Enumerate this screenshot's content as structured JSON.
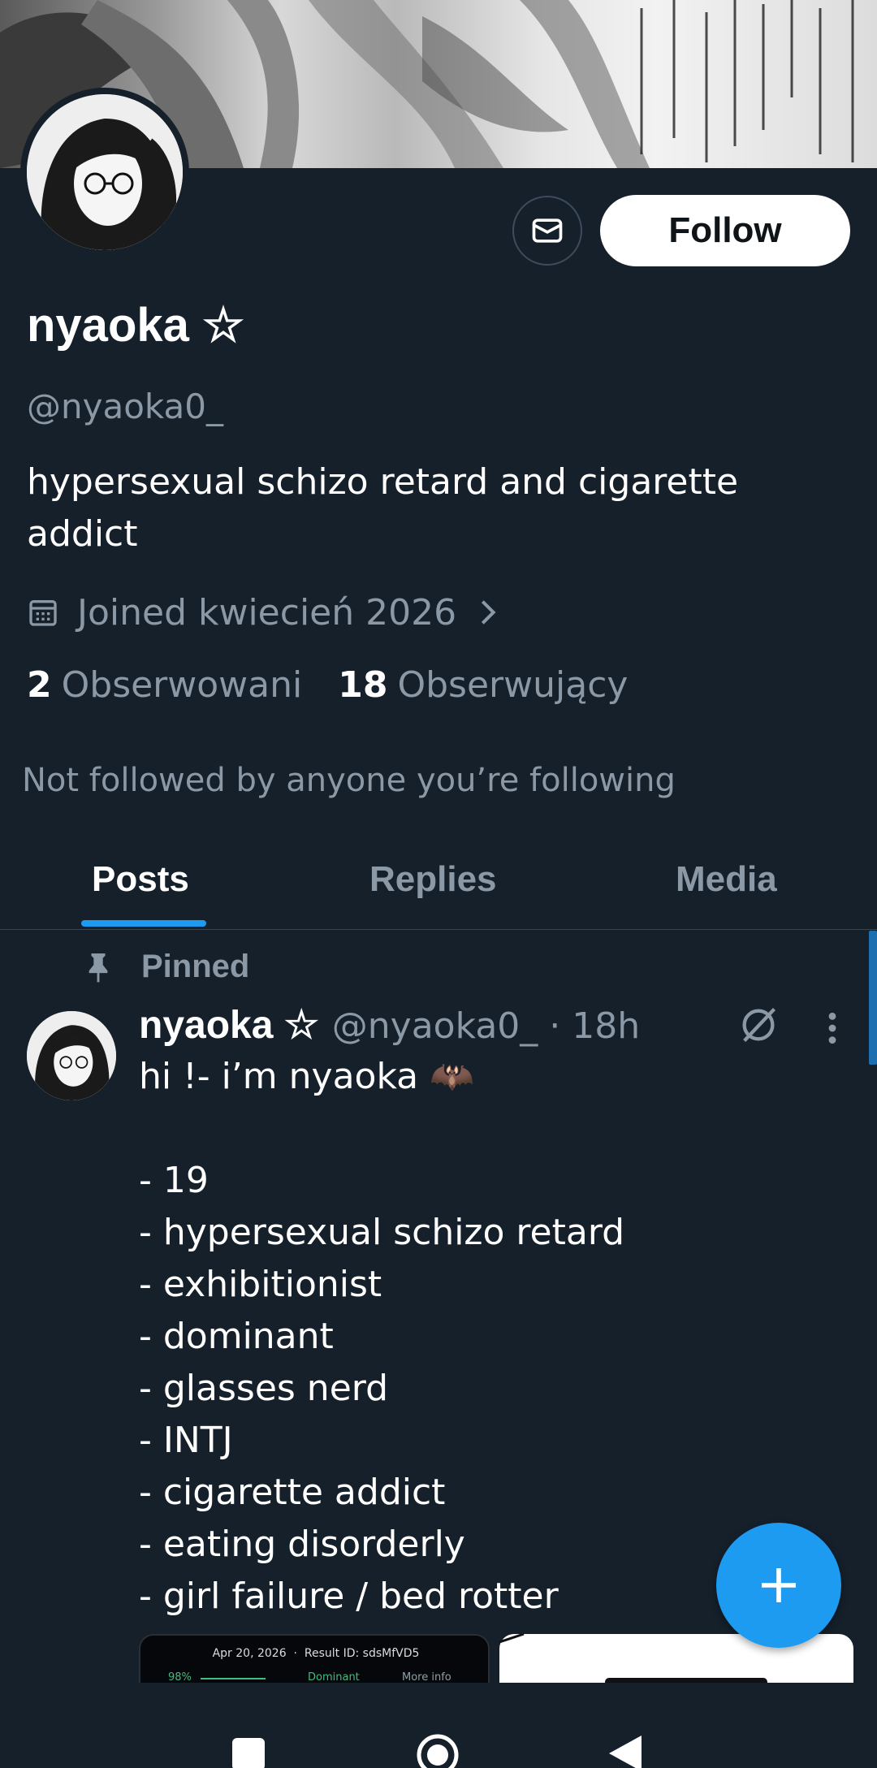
{
  "profile": {
    "display_name": "nyaoka ☆",
    "handle": "@nyaoka0_",
    "bio": "hypersexual schizo retard and cigarette addict",
    "joined": "Joined kwiecień 2026",
    "following_count": "2",
    "following_label": "Obserwowani",
    "followers_count": "18",
    "followers_label": "Obserwujący",
    "not_followed_text": "Not followed by anyone you’re following"
  },
  "actions": {
    "follow_label": "Follow",
    "message_icon": "envelope-icon"
  },
  "tabs": [
    {
      "label": "Posts",
      "active": true
    },
    {
      "label": "Replies",
      "active": false
    },
    {
      "label": "Media",
      "active": false
    }
  ],
  "pinned_post": {
    "pinned_label": "Pinned",
    "author_name": "nyaoka ☆",
    "author_handle": "@nyaoka0_ · 18h",
    "lines": [
      "hi !- i’m nyaoka 🦇",
      "",
      "- 19",
      "- hypersexual schizo retard",
      "- exhibitionist",
      "- dominant",
      "- glasses nerd",
      "- INTJ",
      "- cigarette addict",
      "- eating disorderly",
      "- girl failure / bed rotter"
    ],
    "media": {
      "date": "Apr 20, 2026",
      "result_id": "Result ID:  sdsMfVD5",
      "percent": "98%",
      "trait": "Dominant",
      "more_info": "More info"
    }
  },
  "colors": {
    "background": "#15202b",
    "accent": "#1d9bf0",
    "secondary_text": "#8b98a5"
  }
}
